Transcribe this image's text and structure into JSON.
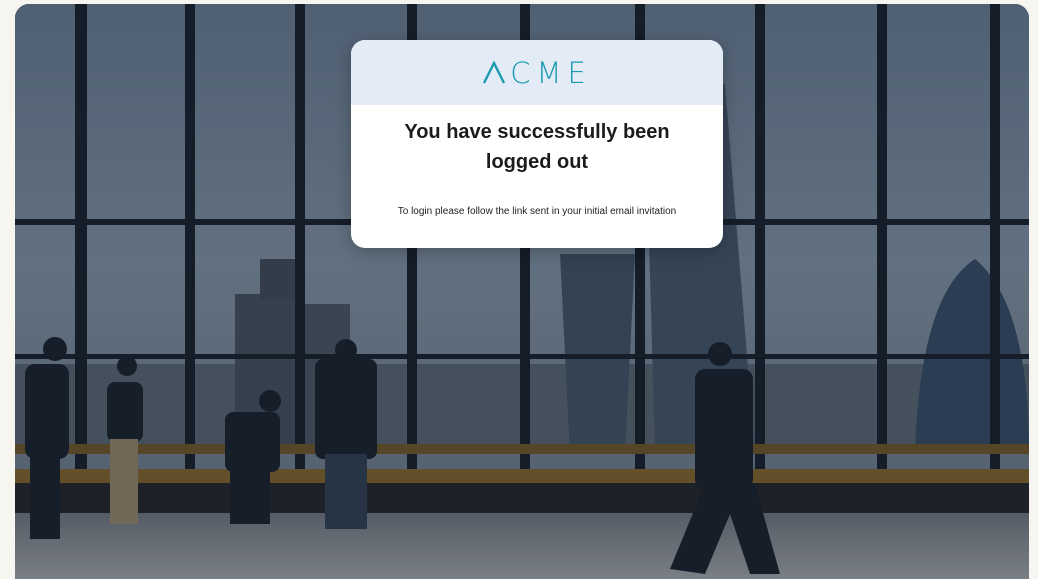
{
  "brand": {
    "logo_text": "CME",
    "logo_full": "ACME",
    "accent": "#1a9bb0"
  },
  "card": {
    "title": "You have successfully been logged out",
    "message": "To login please follow the link sent in your initial email invitation",
    "header_bg": "#e3ebf6"
  },
  "background": {
    "description_icon": "office-window-photo"
  }
}
